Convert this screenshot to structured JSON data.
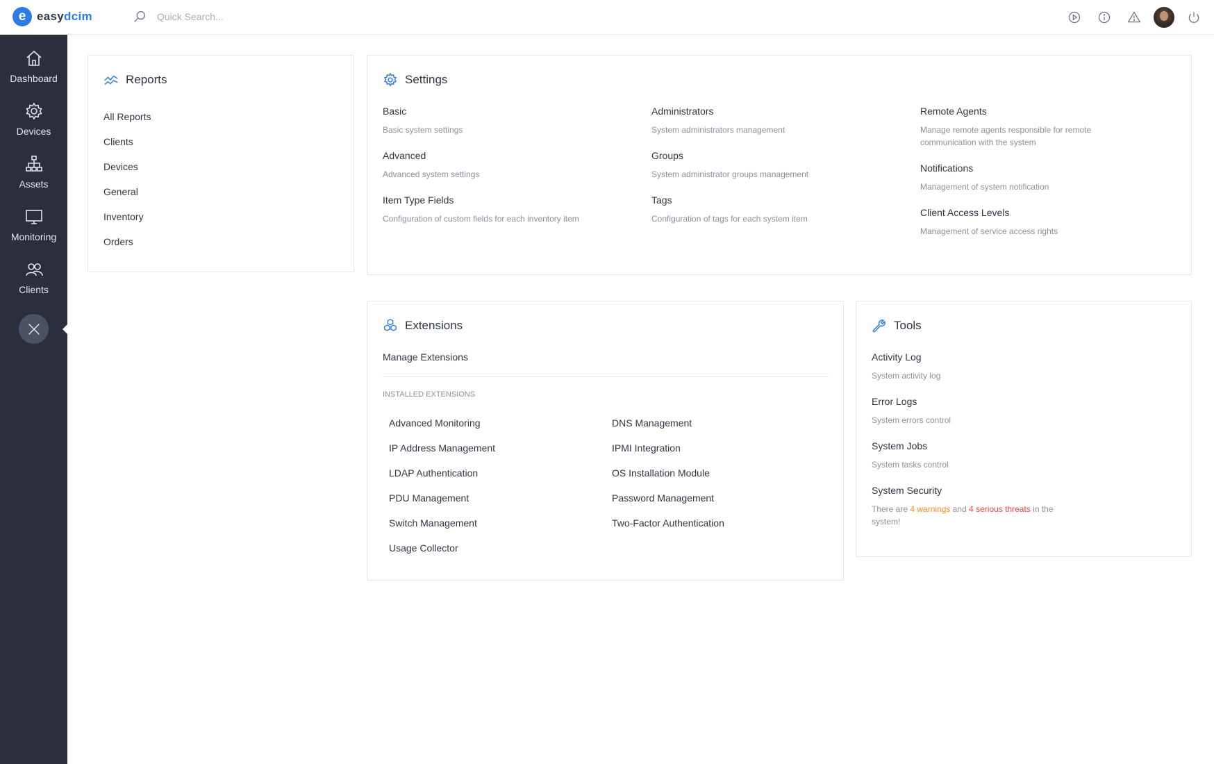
{
  "app": {
    "logo_text_a": "easy",
    "logo_text_b": "dcim",
    "logo_mark": "e"
  },
  "search": {
    "placeholder": "Quick Search..."
  },
  "top_actions": [
    "play-circle-icon",
    "info-icon",
    "alert-triangle-icon",
    "avatar",
    "power-icon"
  ],
  "sidebar": {
    "items": [
      {
        "label": "Dashboard",
        "icon": "home-icon"
      },
      {
        "label": "Devices",
        "icon": "gear-icon"
      },
      {
        "label": "Assets",
        "icon": "network-icon"
      },
      {
        "label": "Monitoring",
        "icon": "monitor-icon"
      },
      {
        "label": "Clients",
        "icon": "users-icon"
      }
    ],
    "close_icon": "close-icon"
  },
  "reports": {
    "title": "Reports",
    "items": [
      "All Reports",
      "Clients",
      "Devices",
      "General",
      "Inventory",
      "Orders"
    ]
  },
  "settings": {
    "title": "Settings",
    "columns": [
      [
        {
          "title": "Basic",
          "desc": "Basic system settings"
        },
        {
          "title": "Advanced",
          "desc": "Advanced system settings"
        },
        {
          "title": "Item Type Fields",
          "desc": "Configuration of custom fields for each inventory item"
        }
      ],
      [
        {
          "title": "Administrators",
          "desc": "System administrators management"
        },
        {
          "title": "Groups",
          "desc": "System administrator groups management"
        },
        {
          "title": "Tags",
          "desc": "Configuration of tags for each system item"
        }
      ],
      [
        {
          "title": "Remote Agents",
          "desc": "Manage remote agents responsible for remote communication with the system"
        },
        {
          "title": "Notifications",
          "desc": "Management of system notification"
        },
        {
          "title": "Client Access Levels",
          "desc": "Management of service access rights"
        }
      ]
    ]
  },
  "extensions": {
    "title": "Extensions",
    "manage_label": "Manage Extensions",
    "section_label": "INSTALLED EXTENSIONS",
    "left": [
      "Advanced Monitoring",
      "IP Address Management",
      "LDAP Authentication",
      "PDU Management",
      "Switch Management",
      "Usage Collector"
    ],
    "right": [
      "DNS Management",
      "IPMI Integration",
      "OS Installation Module",
      "Password Management",
      "Two-Factor Authentication"
    ]
  },
  "tools": {
    "title": "Tools",
    "items": [
      {
        "title": "Activity Log",
        "desc": "System activity log"
      },
      {
        "title": "Error Logs",
        "desc": "System errors control"
      },
      {
        "title": "System Jobs",
        "desc": "System tasks control"
      }
    ],
    "security": {
      "title": "System Security",
      "prefix": "There are ",
      "warnings": "4 warnings",
      "middle": " and ",
      "threats": "4 serious threats",
      "suffix": " in the system!"
    }
  },
  "colors": {
    "accent": "#2f7be5",
    "sidebar_bg": "#2b2f3b",
    "warning": "#f5891f",
    "danger": "#e8453c"
  }
}
